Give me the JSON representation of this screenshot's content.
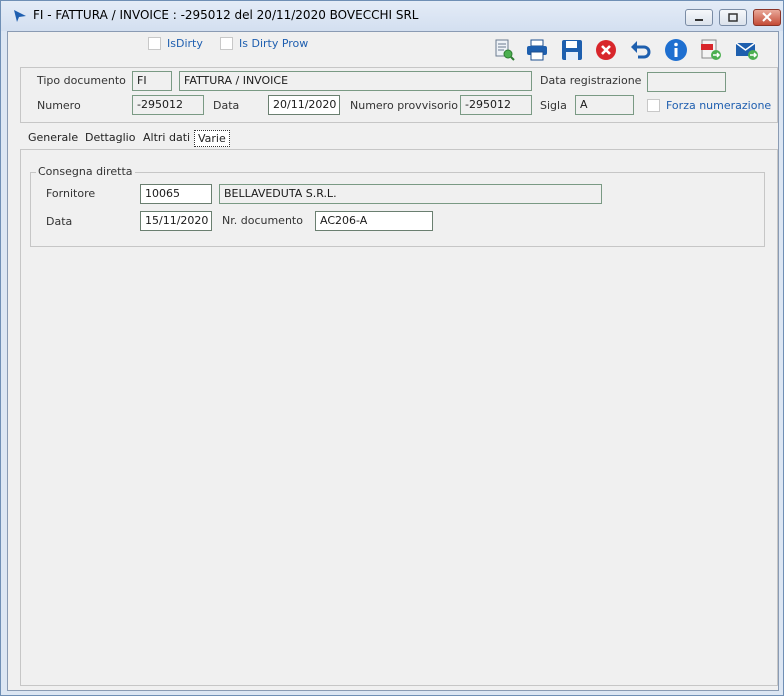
{
  "window": {
    "title": "FI - FATTURA / INVOICE : -295012 del 20/11/2020  BOVECCHI SRL"
  },
  "toolbar": {
    "isdirty_label": "IsDirty",
    "isdirtyprow_label": "Is Dirty Prow",
    "icons": [
      "preview-icon",
      "print-icon",
      "save-icon",
      "delete-icon",
      "undo-icon",
      "info-icon",
      "pdf-icon",
      "email-icon"
    ]
  },
  "header": {
    "tipo_documento_label": "Tipo documento",
    "tipo_documento_code": "FI",
    "tipo_documento_desc": "FATTURA / INVOICE",
    "data_registrazione_label": "Data registrazione",
    "data_registrazione_value": "",
    "numero_label": "Numero",
    "numero_value": "-295012",
    "data_label": "Data",
    "data_value": "20/11/2020",
    "numero_provvisorio_label": "Numero provvisorio",
    "numero_provvisorio_value": "-295012",
    "sigla_label": "Sigla",
    "sigla_value": "A",
    "forza_numerazione_label": "Forza numerazione"
  },
  "tabs": [
    {
      "label": "Generale"
    },
    {
      "label": "Dettaglio"
    },
    {
      "label": "Altri dati"
    },
    {
      "label": "Varie"
    }
  ],
  "consegna": {
    "title": "Consegna diretta",
    "fornitore_label": "Fornitore",
    "fornitore_code": "10065",
    "fornitore_name": "BELLAVEDUTA S.R.L.",
    "data_label": "Data",
    "data_value": "15/11/2020",
    "nr_documento_label": "Nr. documento",
    "nr_documento_value": "AC206-A"
  },
  "colors": {
    "accent": "#1f5fb0",
    "field_border": "#7a9a84",
    "panel": "#f0f0f0"
  }
}
